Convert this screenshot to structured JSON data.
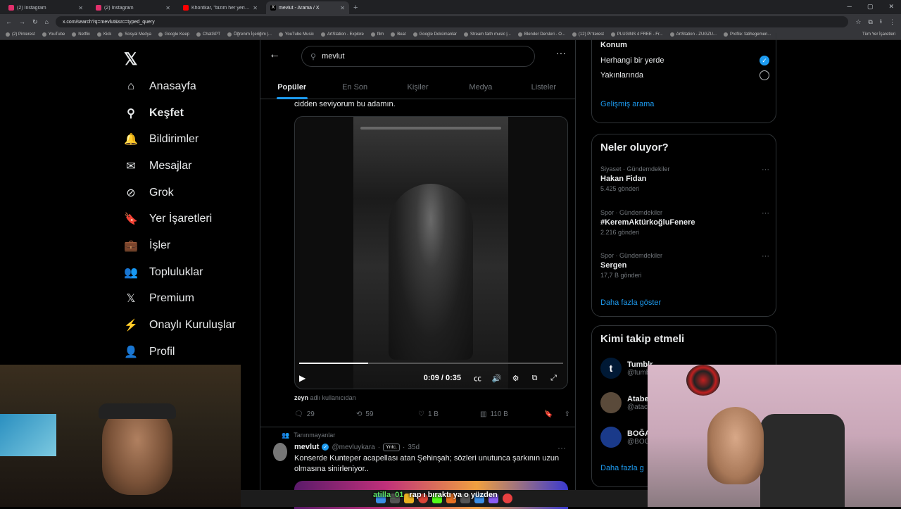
{
  "browser": {
    "tabs": [
      {
        "label": "(2) Instagram",
        "color": "#e1306c",
        "active": false
      },
      {
        "label": "(2) Instagram",
        "color": "#e1306c",
        "active": false
      },
      {
        "label": "Khontkar, \"bizim her yerimiz bi...",
        "color": "#ff0000",
        "active": false
      },
      {
        "label": "mevlut - Arama / X",
        "color": "#ffffff",
        "active": true
      }
    ],
    "url": "x.com/search?q=mevlut&src=typed_query",
    "bookmarks": [
      "(2) Pinterest",
      "YouTube",
      "Netflix",
      "Kick",
      "Sosyal Medya",
      "Google Keep",
      "ChatGPT",
      "Öğrenim İçeriğim |...",
      "YouTube Music",
      "ArtStation - Explore",
      "film",
      "Beat",
      "Google Dokümanlar",
      "Stream faith music |...",
      "Blender Dersleri - O...",
      "(12) Pinterest",
      "PLUGINS 4 FREE - Fr...",
      "ArtStation - ZUGZU...",
      "Profile: fatihegemen..."
    ],
    "bookmarks_right": "Tüm Yer İşaretleri"
  },
  "nav": {
    "items": [
      {
        "label": "Anasayfa",
        "icon": "home-icon",
        "glyph": "⌂"
      },
      {
        "label": "Keşfet",
        "icon": "search-icon",
        "glyph": "⚲",
        "active": true
      },
      {
        "label": "Bildirimler",
        "icon": "bell-icon",
        "glyph": "🔔"
      },
      {
        "label": "Mesajlar",
        "icon": "mail-icon",
        "glyph": "✉"
      },
      {
        "label": "Grok",
        "icon": "grok-icon",
        "glyph": "⊘"
      },
      {
        "label": "Yer İşaretleri",
        "icon": "bookmark-icon",
        "glyph": "🔖"
      },
      {
        "label": "İşler",
        "icon": "briefcase-icon",
        "glyph": "💼"
      },
      {
        "label": "Topluluklar",
        "icon": "communities-icon",
        "glyph": "👥"
      },
      {
        "label": "Premium",
        "icon": "x-logo-icon",
        "glyph": "𝕏"
      },
      {
        "label": "Onaylı Kuruluşlar",
        "icon": "lightning-icon",
        "glyph": "⚡"
      },
      {
        "label": "Profil",
        "icon": "profile-icon",
        "glyph": "👤"
      }
    ]
  },
  "search": {
    "query": "mevlut",
    "tabs": [
      "Popüler",
      "En Son",
      "Kişiler",
      "Medya",
      "Listeler"
    ]
  },
  "tweet1": {
    "text": "cidden seviyorum bu adamın.",
    "time": "0:09 / 0:35",
    "progress": 0.26,
    "attribution_user": "zeyn",
    "attribution_suffix": "adlı kullanıcıdan",
    "replies": "29",
    "retweets": "59",
    "likes": "1 B",
    "views": "110 B"
  },
  "tweet2": {
    "context": "Tanınmayanlar",
    "name": "mevlut",
    "handle": "@mevluykara",
    "badge": "Yntc.",
    "age": "35d",
    "text": "Konserde Kunteper acapellası atan Şehinşah; sözleri unutunca şarkının uzun olmasına sinirleniyor.."
  },
  "location": {
    "title": "Konum",
    "anywhere": "Herhangi bir yerde",
    "nearby": "Yakınlarında",
    "advanced": "Gelişmiş arama"
  },
  "trends": {
    "title": "Neler oluyor?",
    "items": [
      {
        "meta": "Siyaset · Gündemdekiler",
        "name": "Hakan Fidan",
        "count": "5.425 gönderi"
      },
      {
        "meta": "Spor · Gündemdekiler",
        "name": "#KeremAktürkoğluFenere",
        "count": "2.216 gönderi"
      },
      {
        "meta": "Spor · Gündemdekiler",
        "name": "Sergen",
        "count": "17,7 B gönderi"
      }
    ],
    "show_more": "Daha fazla göster"
  },
  "who_to_follow": {
    "title": "Kimi takip etmeli",
    "items": [
      {
        "name": "Tumblr",
        "handle": "@tumb",
        "initial": "t",
        "color": "#001935"
      },
      {
        "name": "Atabe",
        "handle": "@atac",
        "initial": "",
        "color": "#5a4a3a"
      },
      {
        "name": "BOĞA",
        "handle": "@BOG",
        "initial": "",
        "color": "#1a3a8a"
      }
    ],
    "show_more": "Daha fazla g"
  },
  "chat": {
    "user": "atilla_01",
    "message": "rap ı bıraktı ya o yüzden"
  },
  "colors": {
    "accent": "#1d9bf0",
    "border": "#2f3336",
    "muted": "#71767b"
  }
}
